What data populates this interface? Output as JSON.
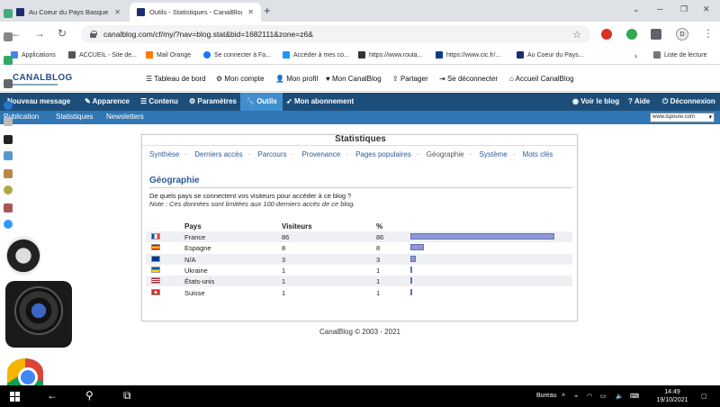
{
  "browser": {
    "tabs": [
      {
        "title": "Au Coeur du Pays Basque (SPC",
        "active": false
      },
      {
        "title": "Outils - Statistiques - CanalBlog",
        "active": true
      }
    ],
    "new_tab": "+",
    "url": "canalblog.com/cf/my/?nav=blog.stat&bid=1682111&zone=z6&",
    "avatar_letter": "D",
    "bookmarks": [
      "Applications",
      "ACCUEIL - Site de...",
      "Mail Orange",
      "Se connecter à Fa...",
      "Accéder à mes co...",
      "https://www.routa...",
      "https://www.cic.fr/...",
      "Au Coeur du Pays...",
      "Liste de lecture"
    ]
  },
  "canalblog": {
    "logo": "CANALBLOG",
    "top_links": [
      "Tableau de bord",
      "Mon compte",
      "Mon profil",
      "Mon CanalBlog",
      "Partager",
      "Se déconnecter",
      "Accueil CanalBlog"
    ],
    "menu": [
      "Nouveau message",
      "Apparence",
      "Contenu",
      "Paramètres",
      "Outils",
      "Mon abonnement"
    ],
    "menu_right": [
      "Voir le blog",
      "Aide",
      "Déconnexion"
    ],
    "submenu": [
      "Publication",
      "Statistiques",
      "Newsletters"
    ],
    "blog_select": "www.ispoure.com"
  },
  "stats": {
    "title": "Statistiques",
    "subnav": [
      "Synthèse",
      "Derniers accès",
      "Parcours",
      "Provenance",
      "Pages populaires",
      "Géographie",
      "Système",
      "Mots clés"
    ],
    "current": "Géographie",
    "section_title": "Géographie",
    "description": "De quels pays se connectent vos visiteurs pour accéder à ce blog ?",
    "note": "Note : Ces données sont limitées aux 100 derniers accès de ce blog.",
    "headers": {
      "country": "Pays",
      "visitors": "Visiteurs",
      "percent": "%"
    },
    "rows": [
      {
        "country": "France",
        "visitors": "86",
        "percent": "86",
        "pct": 86,
        "flag": "fr"
      },
      {
        "country": "Espagne",
        "visitors": "8",
        "percent": "8",
        "pct": 8,
        "flag": "es"
      },
      {
        "country": "N/A",
        "visitors": "3",
        "percent": "3",
        "pct": 3,
        "flag": "eu"
      },
      {
        "country": "Ukraine",
        "visitors": "1",
        "percent": "1",
        "pct": 1,
        "flag": "ua"
      },
      {
        "country": "États-unis",
        "visitors": "1",
        "percent": "1",
        "pct": 1,
        "flag": "us"
      },
      {
        "country": "Suisse",
        "visitors": "1",
        "percent": "1",
        "pct": 1,
        "flag": "ch"
      }
    ]
  },
  "footer": "CanalBlog © 2003 - 2021",
  "taskbar": {
    "tray_label": "Bureau",
    "time": "14:49",
    "date": "19/10/2021"
  },
  "colors": {
    "menu": "#1d4e7a",
    "submenu": "#2f77b5",
    "active_menu": "#3f8fcf",
    "bar": "#8e98d6",
    "link": "#2a5a9a"
  }
}
